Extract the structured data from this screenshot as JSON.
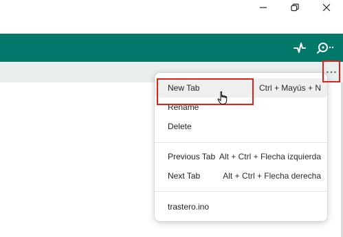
{
  "window": {
    "minimize_icon": "minimize-icon",
    "restore_icon": "restore-icon",
    "close_icon": "close-icon"
  },
  "toolbar": {
    "color": "#00796b",
    "activity_icon": "activity-icon",
    "search_icon": "search-options-icon"
  },
  "tabstrip": {
    "menu_icon": "more-horizontal-icon"
  },
  "context_menu": {
    "items": [
      {
        "label": "New Tab",
        "shortcut": "Ctrl + Mayús + N"
      },
      {
        "label": "Rename",
        "shortcut": ""
      },
      {
        "label": "Delete",
        "shortcut": ""
      },
      {
        "label": "Previous Tab",
        "shortcut": "Alt + Ctrl + Flecha izquierda"
      },
      {
        "label": "Next Tab",
        "shortcut": "Alt + Ctrl + Flecha derecha"
      },
      {
        "label": "trastero.ino",
        "shortcut": ""
      }
    ]
  },
  "highlight_color": "#e0201b"
}
